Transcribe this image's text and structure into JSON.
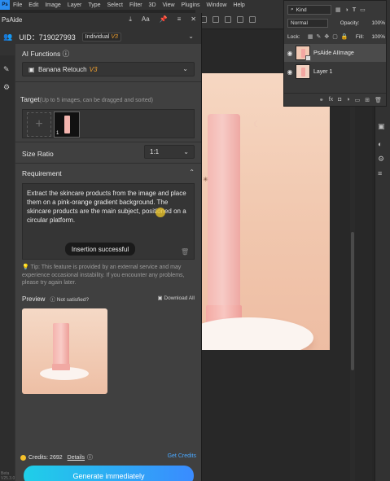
{
  "menubar": {
    "logo": "Ps",
    "items": [
      "File",
      "Edit",
      "Image",
      "Layer",
      "Type",
      "Select",
      "Filter",
      "3D",
      "View",
      "Plugins",
      "Window",
      "Help"
    ]
  },
  "layers_panel": {
    "kind_label": "Kind",
    "blend_mode": "Normal",
    "opacity_label": "Opacity:",
    "opacity_value": "100%",
    "lock_label": "Lock:",
    "fill_label": "Fill:",
    "fill_value": "100%",
    "layers": [
      {
        "name": "PsAide AIImage",
        "selected": true
      },
      {
        "name": "Layer 1",
        "selected": false
      }
    ]
  },
  "plugin": {
    "title": "PsAide",
    "uid_text": "UID：719027993",
    "tier": "Individual",
    "tier_badge": "V3",
    "ai_functions": {
      "label": "AI Functions",
      "selected": "Banana Retouch",
      "version_badge": "V3"
    },
    "target": {
      "label": "Target",
      "hint": "(Up to 5 images, can be dragged and sorted)",
      "images": [
        {
          "index": "1"
        }
      ]
    },
    "size_ratio": {
      "label": "Size Ratio",
      "value": "1:1"
    },
    "requirement": {
      "label": "Requirement",
      "text": "Extract the skincare products from the image and place them on a pink-orange gradient background. The skincare products are the main subject, positioned on a circular platform.",
      "toast": "Insertion successful"
    },
    "tip": "Tip: This feature is provided by an external service and may experience occasional instability. If you encounter any problems, please try again later.",
    "preview": {
      "label": "Preview",
      "not_satisfied": "Not satisfied?",
      "download_all": "Download All"
    },
    "credits": {
      "label": "Credits: 2692",
      "details": "Details",
      "get_credits": "Get Credits"
    },
    "generate_button": "Generate immediately",
    "beta_label": "Beta",
    "version": "V25.3.0"
  },
  "colors": {
    "accent_start": "#1fcfe8",
    "accent_end": "#3a8bff",
    "badge_orange": "#f0a030",
    "link_blue": "#4aa8ff"
  }
}
